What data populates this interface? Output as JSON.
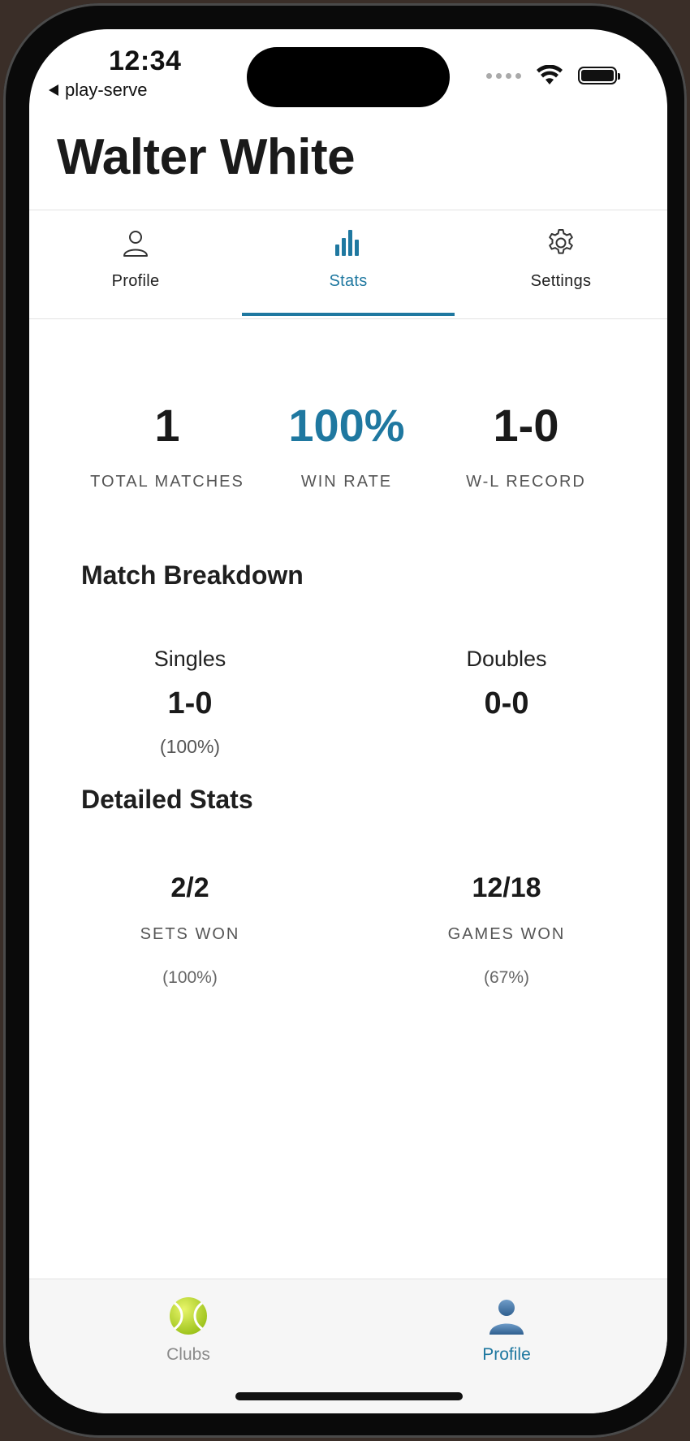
{
  "status_bar": {
    "time": "12:34",
    "back_app": "play-serve"
  },
  "header": {
    "user_name": "Walter White"
  },
  "tabs": [
    {
      "label": "Profile",
      "icon": "person-outline-icon",
      "active": false
    },
    {
      "label": "Stats",
      "icon": "bar-chart-icon",
      "active": true
    },
    {
      "label": "Settings",
      "icon": "gear-icon",
      "active": false
    }
  ],
  "summary": {
    "total_matches": {
      "value": "1",
      "label": "TOTAL MATCHES"
    },
    "win_rate": {
      "value": "100%",
      "label": "WIN RATE"
    },
    "wl_record": {
      "value": "1-0",
      "label": "W-L RECORD"
    }
  },
  "match_breakdown": {
    "title": "Match Breakdown",
    "singles": {
      "title": "Singles",
      "record": "1-0",
      "pct": "(100%)"
    },
    "doubles": {
      "title": "Doubles",
      "record": "0-0"
    }
  },
  "detailed_stats": {
    "title": "Detailed Stats",
    "sets": {
      "value": "2/2",
      "label": "SETS WON",
      "pct": "(100%)"
    },
    "games": {
      "value": "12/18",
      "label": "GAMES WON",
      "pct": "(67%)"
    }
  },
  "bottom_nav": [
    {
      "label": "Clubs",
      "icon": "tennis-ball-icon",
      "active": false
    },
    {
      "label": "Profile",
      "icon": "person-silhouette-icon",
      "active": true
    }
  ],
  "colors": {
    "accent": "#1f78a0",
    "text": "#1a1a1a",
    "muted": "#555555",
    "inactive_nav": "#8a8a8a"
  }
}
